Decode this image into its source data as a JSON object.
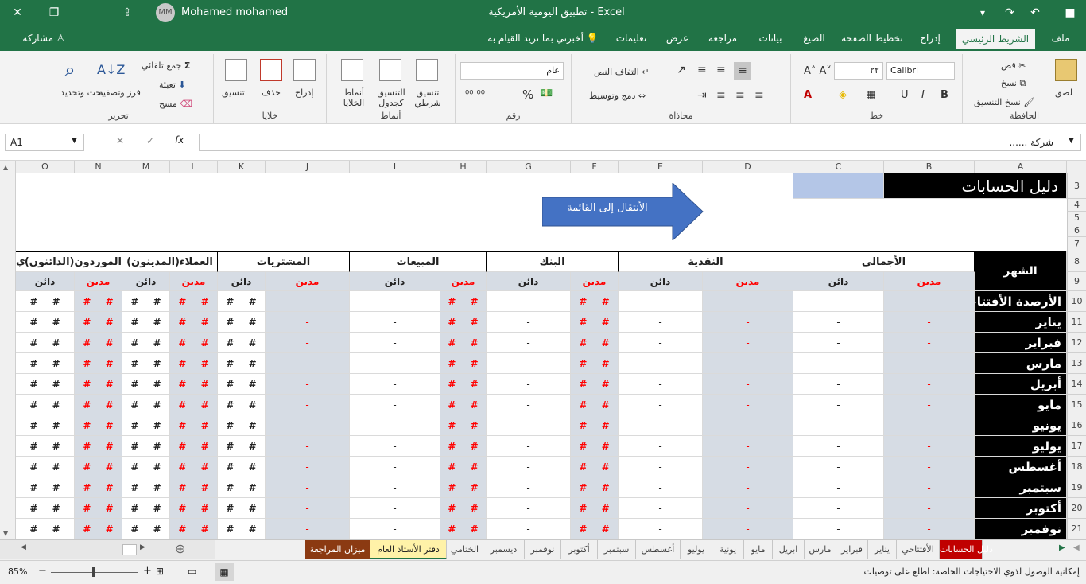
{
  "window": {
    "title": "تطبيق اليومية الأمريكية  -  Excel",
    "user": "Mohamed mohamed",
    "avatar": "MM"
  },
  "menu": {
    "tabs": [
      "ملف",
      "الشريط الرئيسي",
      "إدراج",
      "تخطيط الصفحة",
      "الصيغ",
      "بيانات",
      "مراجعة",
      "عرض",
      "تعليمات"
    ],
    "tell_me": "أخبرني بما تريد القيام به",
    "share": "مشاركة"
  },
  "ribbon": {
    "clipboard": {
      "label": "الحافظة",
      "paste": "لصق",
      "cut": "قص",
      "copy": "نسخ",
      "format_painter": "نسخ التنسيق"
    },
    "font": {
      "label": "خط",
      "name": "Calibri",
      "size": "٢٢"
    },
    "alignment": {
      "label": "محاذاة",
      "wrap": "التفاف النص",
      "merge": "دمج وتوسيط"
    },
    "number": {
      "label": "رقم",
      "format": "عام"
    },
    "styles": {
      "label": "أنماط",
      "conditional": "تنسيق شرطي",
      "as_table": "التنسيق كجدول",
      "cell_styles": "أنماط الخلايا"
    },
    "cells": {
      "label": "خلايا",
      "insert": "إدراج",
      "delete": "حذف",
      "format": "تنسيق"
    },
    "editing": {
      "label": "تحرير",
      "autosum": "جمع تلقائي",
      "fill": "تعبئة",
      "clear": "مسح",
      "sort": "فرز وتصفية",
      "find": "بحث وتحديد"
    }
  },
  "formula_bar": {
    "name_box": "A1",
    "formula": "شركة ......"
  },
  "sheet": {
    "title": "دليل الحسابات",
    "goto_button": "الأنتقال إلى القائمة",
    "month_header": "الشهر",
    "groups": [
      "الأجمالى",
      "النقدية",
      "البنك",
      "المبيعات",
      "المشتريات",
      "العملاء(المدينون)",
      "الموردون(الدائنون)"
    ],
    "debit": "مدين",
    "credit": "دائن",
    "dash": "-",
    "hash": "#",
    "overflow": "ي",
    "months": [
      "الأرصدة الأفتتاحية",
      "يناير",
      "فبراير",
      "مارس",
      "أبريل",
      "مايو",
      "يونيو",
      "يوليو",
      "أغسطس",
      "سبتمبر",
      "أكتوبر",
      "نوفمبر"
    ],
    "columns": [
      "A",
      "B",
      "C",
      "D",
      "E",
      "F",
      "G",
      "H",
      "I",
      "J",
      "K",
      "L",
      "M",
      "N",
      "O"
    ],
    "rows": [
      "3",
      "4",
      "5",
      "6",
      "7",
      "8",
      "9",
      "10",
      "11",
      "12",
      "13",
      "14",
      "15",
      "16",
      "17",
      "18",
      "19",
      "20",
      "21"
    ]
  },
  "sheets": [
    "دليل الحسابات",
    "الأفتتاحي",
    "يناير",
    "فبراير",
    "مارس",
    "ابريل",
    "مايو",
    "يونية",
    "يوليو",
    "أغسطس",
    "سبتمبر",
    "أكتوبر",
    "نوفمبر",
    "ديسمبر",
    "الختامي",
    "دفتر الأستاذ العام",
    "ميزان المراجعة"
  ],
  "status": {
    "zoom": "85%",
    "accessibility": "إمكانية الوصول لذوي الاحتياجات الخاصة: اطلع على توصيات"
  },
  "colors": {
    "excel_green": "#217346",
    "black_cell": "#000000",
    "blue_cell": "#b4c6e7",
    "gray_cell": "#d6dce4",
    "red_text": "#ff0000",
    "arrow": "#4472c4",
    "active_tab_bg": "#c00000",
    "gold_tab": "#fff2a8",
    "brown_tab": "#8b3a12"
  }
}
